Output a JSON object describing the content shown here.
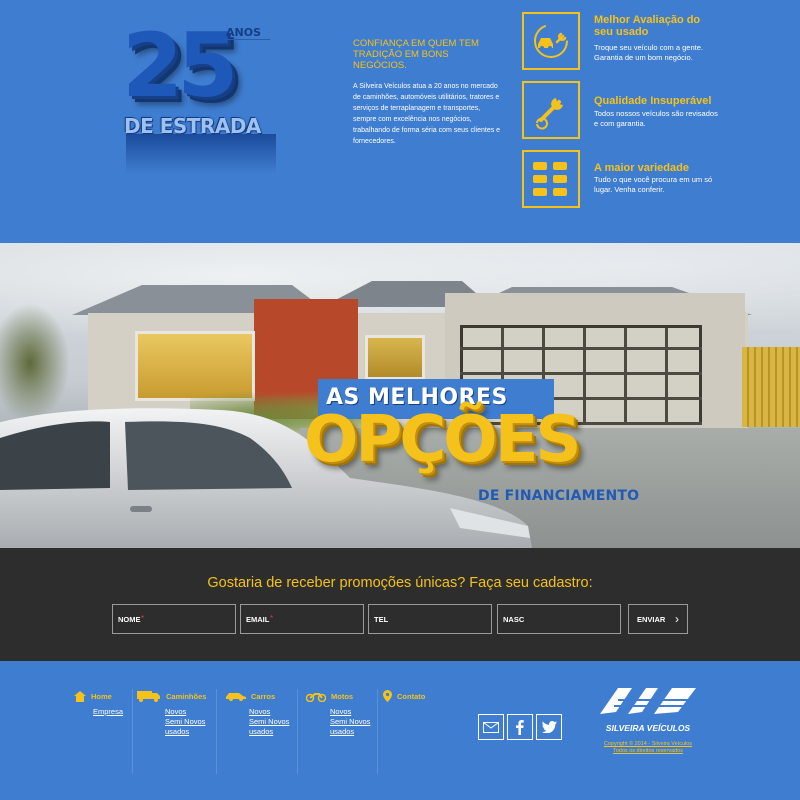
{
  "logo": {
    "number": "25",
    "anos": "ANOS",
    "estrada": "DE ESTRADA"
  },
  "about": {
    "title": "CONFIANÇA EM QUEM TEM TRADIÇÃO EM BONS NEGÓCIOS.",
    "text": "A Silveira Veículos atua a 20 anos no mercado de caminhões, automóveis utilitários, tratores e serviços de terraplanagem e transportes, sempre com excelência nos negócios, trabalhando de forma séria com seus clientes e fornecedores."
  },
  "features": [
    {
      "icon": "car-wrench-icon",
      "title": "Melhor Avaliação do seu usado",
      "text": "Troque seu veículo com a gente. Garantia de um bom negócio."
    },
    {
      "icon": "wrench-icon",
      "title": "Qualidade Insuperável",
      "text": "Todos nossos veículos são revisados e com garantia."
    },
    {
      "icon": "cars-grid-icon",
      "title": "A maior variedade",
      "text": "Tudo o que você procura em um só lugar. Venha conferir."
    }
  ],
  "banner": {
    "line1": "AS MELHORES",
    "line2": "OPÇÕES",
    "line3": "DE FINANCIAMENTO"
  },
  "signup": {
    "title": "Gostaria de receber promoções únicas? Faça seu cadastro:",
    "fields": [
      {
        "placeholder": "NOME",
        "required": "*"
      },
      {
        "placeholder": "EMAIL",
        "required": "*"
      },
      {
        "placeholder": "TEL"
      },
      {
        "placeholder": "NASC"
      }
    ],
    "button": "ENVIAR",
    "button_icon": "›"
  },
  "footer": {
    "home": {
      "label": "Home",
      "links": [
        "Empresa"
      ]
    },
    "caminhoes": {
      "label": "Caminhões",
      "links": [
        "Novos",
        "Semi Novos",
        "usados"
      ]
    },
    "carros": {
      "label": "Carros",
      "links": [
        "Novos",
        "Semi Novos",
        "usados"
      ]
    },
    "motos": {
      "label": "Motos",
      "links": [
        "Novos",
        "Semi Novos",
        "usados"
      ]
    },
    "contato": {
      "label": "Contato"
    },
    "brand": "SILVEIRA VEÍCULOS",
    "copyright": [
      "Copyright © 2014 - Silveira Veículos",
      "Todos os direitos reservados"
    ]
  },
  "colors": {
    "blue": "#3f7dd1",
    "yellow": "#f4c21b",
    "dark": "#2d2d2d"
  }
}
